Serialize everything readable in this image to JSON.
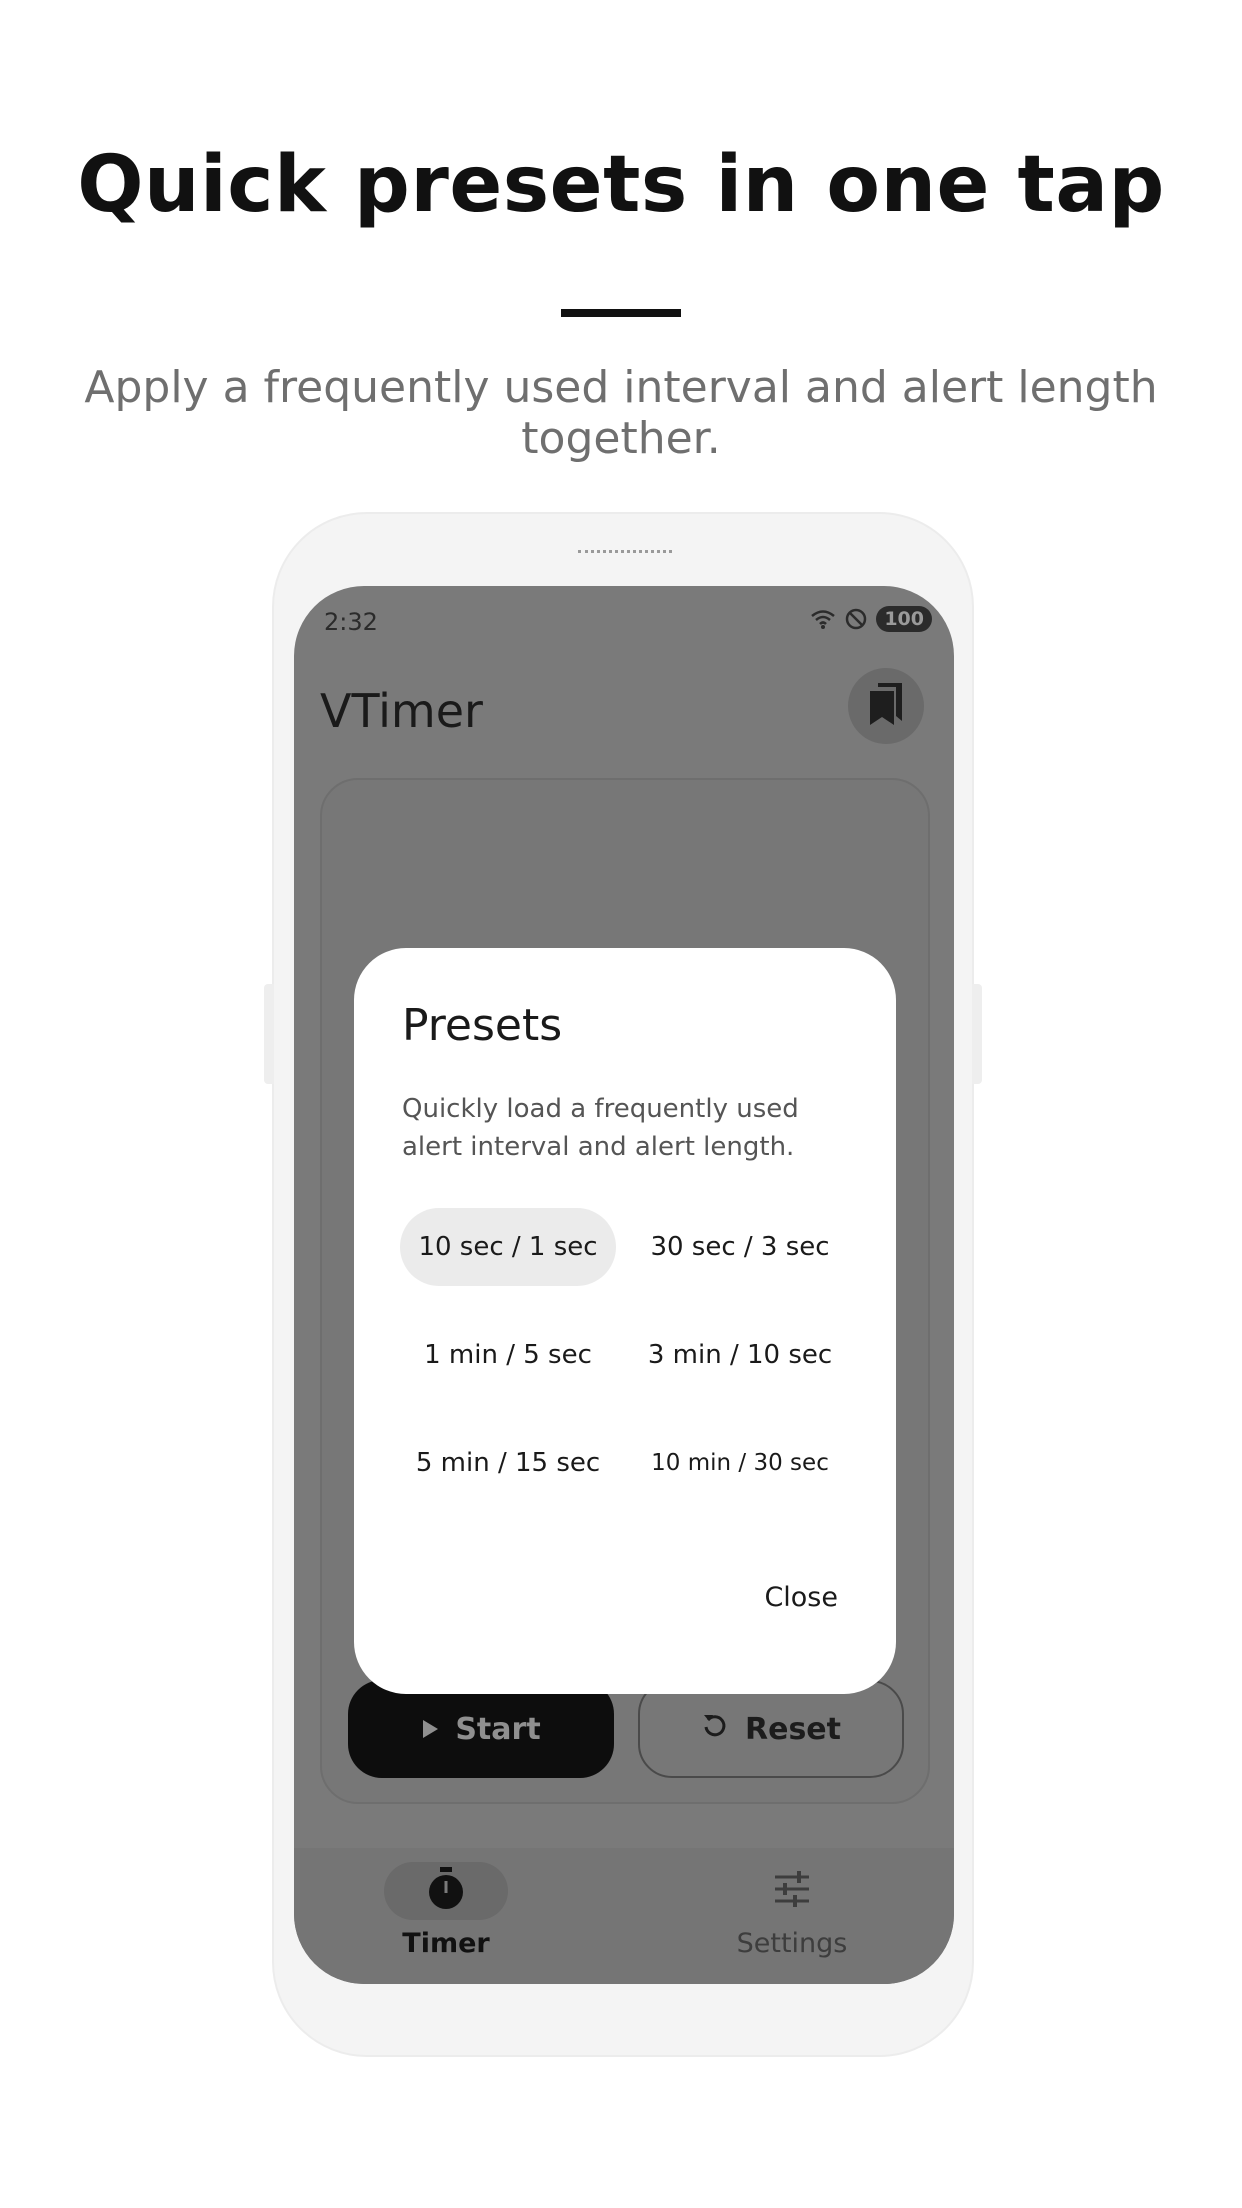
{
  "headline": "Quick presets in one tap",
  "subheadline": "Apply a frequently used interval and alert length together.",
  "status_bar": {
    "time": "2:32",
    "battery": "100"
  },
  "app": {
    "title": "VTimer",
    "bookmark_icon": "bookmarks-icon"
  },
  "controls": {
    "start_label": "Start",
    "reset_label": "Reset"
  },
  "bottom_nav": {
    "items": [
      {
        "label": "Timer",
        "icon": "stopwatch-icon",
        "selected": true
      },
      {
        "label": "Settings",
        "icon": "sliders-icon",
        "selected": false
      }
    ]
  },
  "dialog": {
    "title": "Presets",
    "description": "Quickly load a frequently used alert interval and alert length.",
    "presets": [
      {
        "label": "10 sec / 1 sec",
        "selected": true
      },
      {
        "label": "30 sec / 3 sec",
        "selected": false
      },
      {
        "label": "1 min / 5 sec",
        "selected": false
      },
      {
        "label": "3 min / 10 sec",
        "selected": false
      },
      {
        "label": "5 min / 15 sec",
        "selected": false
      },
      {
        "label": "10 min / 30 sec",
        "selected": false
      }
    ],
    "close_label": "Close"
  },
  "colors": {
    "scrim": "#7a7a7a",
    "dialog_bg": "#ffffff",
    "selected_chip": "#ebebeb",
    "start_button": "#0d0d0d"
  }
}
